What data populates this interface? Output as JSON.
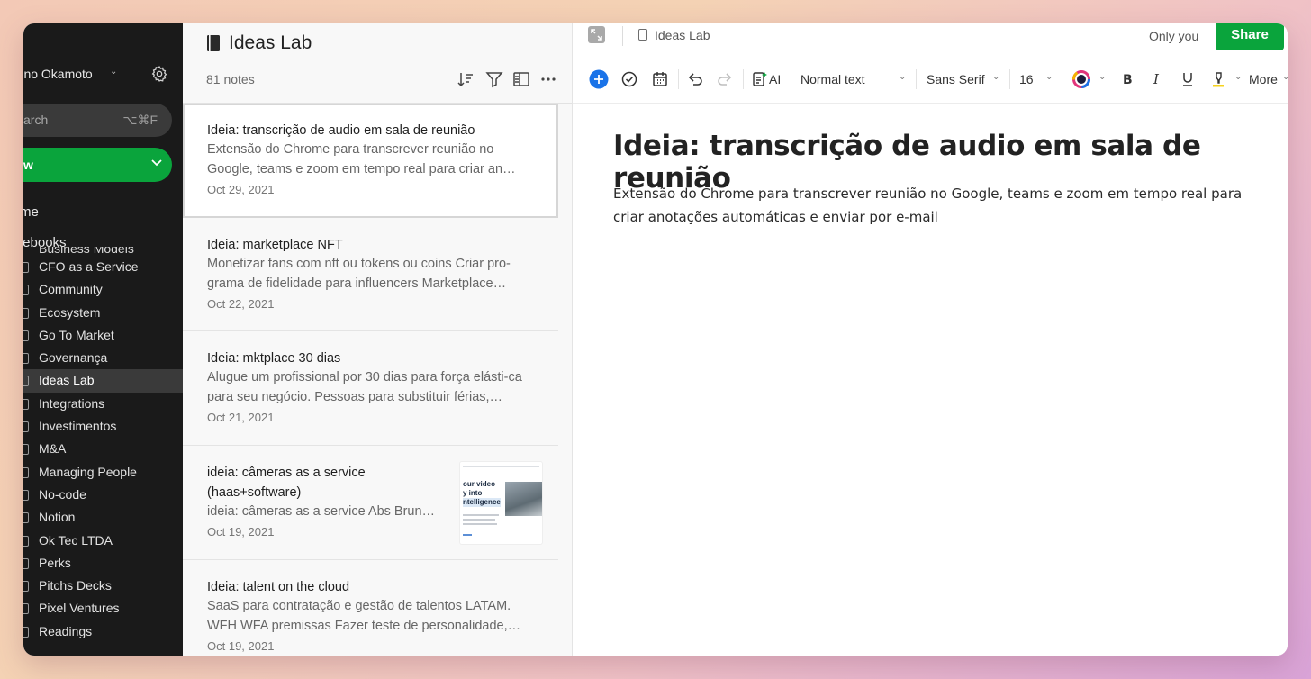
{
  "sidebar": {
    "user_name": "runo Okamoto",
    "search_label": "arch",
    "search_shortcut": "⌥⌘F",
    "new_label": "w",
    "home_label": "me",
    "notebooks_label": "tebooks",
    "cut_item": "Business Models",
    "notebooks": [
      {
        "label": "CFO as a Service"
      },
      {
        "label": "Community"
      },
      {
        "label": "Ecosystem"
      },
      {
        "label": "Go To Market"
      },
      {
        "label": "Governança"
      },
      {
        "label": "Ideas Lab"
      },
      {
        "label": "Integrations"
      },
      {
        "label": "Investimentos"
      },
      {
        "label": "M&A"
      },
      {
        "label": "Managing People"
      },
      {
        "label": "No-code"
      },
      {
        "label": "Notion"
      },
      {
        "label": "Ok Tec LTDA"
      },
      {
        "label": "Perks"
      },
      {
        "label": "Pitchs Decks"
      },
      {
        "label": "Pixel Ventures"
      },
      {
        "label": "Readings"
      }
    ],
    "active_notebook": "Ideas Lab"
  },
  "notelist": {
    "title": "Ideas Lab",
    "count": "81 notes",
    "notes": [
      {
        "title": "Ideia: transcrição de audio em sala de reunião",
        "snippet": "Extensão do Chrome para transcrever reunião no Google, teams e zoom em tempo real para criar an…",
        "date": "Oct 29, 2021"
      },
      {
        "title": "Ideia: marketplace NFT",
        "snippet": "Monetizar fans com nft ou tokens ou coins Criar pro-grama de fidelidade para influencers Marketplace…",
        "date": "Oct 22, 2021"
      },
      {
        "title": "Ideia: mktplace 30 dias",
        "snippet": "Alugue um profissional por 30 dias para força elásti-ca para seu negócio. Pessoas para substituir férias,…",
        "date": "Oct 21, 2021"
      },
      {
        "title": "ideia: câmeras as a service (haas+software)",
        "snippet": "ideia: câmeras as a service Abs Brun…",
        "date": "Oct 19, 2021",
        "thumb_text": [
          "our video",
          "y into",
          "ntelligence"
        ]
      },
      {
        "title": "Ideia: talent on the cloud",
        "snippet": "SaaS para contratação e gestão de talentos LATAM. WFH WFA premissas Fazer teste de personalidade,…",
        "date": "Oct 19, 2021"
      }
    ]
  },
  "editor": {
    "notebook_label": "Ideas Lab",
    "sharing_status": "Only you",
    "share_label": "Share",
    "toolbar": {
      "ai_label": "AI",
      "text_style": "Normal text",
      "font": "Sans Serif",
      "font_size": "16",
      "more_label": "More"
    },
    "note_title": "Ideia: transcrição de audio em sala de reunião",
    "note_body": "Extensão do Chrome para transcrever reunião no Google, teams e zoom em tempo real para criar anotações automáticas e enviar por e-mail"
  },
  "colors": {
    "sidebar_bg": "#1a1a1a",
    "accent_green": "#0aa43c",
    "insert_blue": "#1a73e8"
  }
}
